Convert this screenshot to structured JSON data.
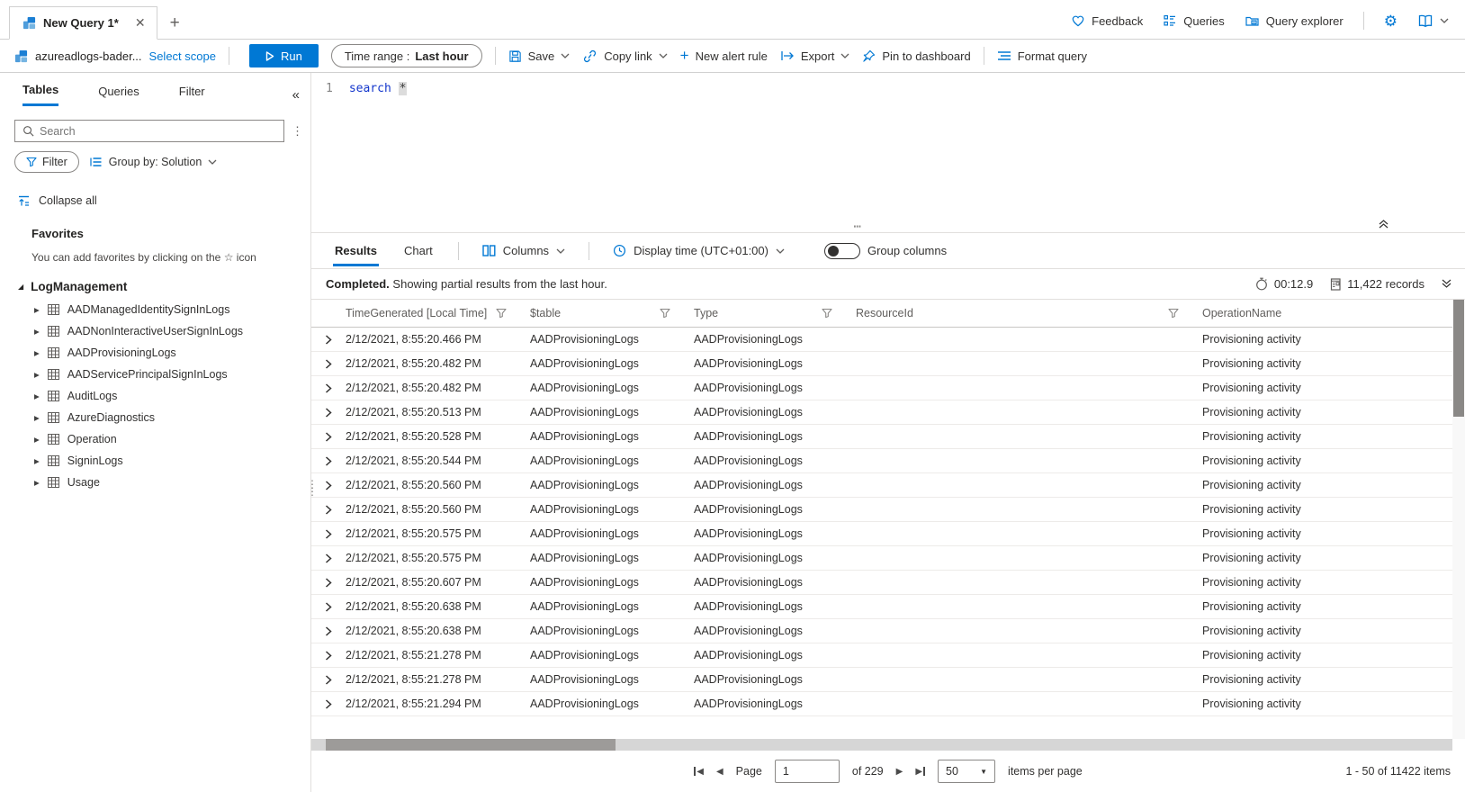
{
  "tab_bar": {
    "tab_title": "New Query 1*",
    "actions": {
      "feedback": "Feedback",
      "queries": "Queries",
      "query_explorer": "Query explorer"
    }
  },
  "toolbar": {
    "scope_name": "azureadlogs-bader...",
    "select_scope": "Select scope",
    "run_label": "Run",
    "time_range_label": "Time range :",
    "time_range_value": "Last hour",
    "save_label": "Save",
    "copy_link_label": "Copy link",
    "new_alert_rule_label": "New alert rule",
    "export_label": "Export",
    "pin_label": "Pin to dashboard",
    "format_query_label": "Format query"
  },
  "sidebar": {
    "tabs": [
      "Tables",
      "Queries",
      "Filter"
    ],
    "search_placeholder": "Search",
    "filter_button": "Filter",
    "group_by_label": "Group by: Solution",
    "collapse_all": "Collapse all",
    "favorites_title": "Favorites",
    "favorites_hint": "You can add favorites by clicking on the ☆ icon",
    "group_name": "LogManagement",
    "tables": [
      "AADManagedIdentitySignInLogs",
      "AADNonInteractiveUserSignInLogs",
      "AADProvisioningLogs",
      "AADServicePrincipalSignInLogs",
      "AuditLogs",
      "AzureDiagnostics",
      "Operation",
      "SigninLogs",
      "Usage"
    ]
  },
  "editor": {
    "line_number": "1",
    "keyword": "search",
    "operator": "*"
  },
  "results": {
    "tabs": [
      "Results",
      "Chart"
    ],
    "columns_label": "Columns",
    "display_time_label": "Display time (UTC+01:00)",
    "group_columns_label": "Group columns",
    "status": {
      "completed": "Completed.",
      "message": "Showing partial results from the last hour.",
      "elapsed": "00:12.9",
      "records": "11,422 records"
    }
  },
  "table": {
    "headers": [
      {
        "label": "TimeGenerated [Local Time]",
        "filter": true
      },
      {
        "label": "$table",
        "filter": true
      },
      {
        "label": "Type",
        "filter": true
      },
      {
        "label": "ResourceId",
        "filter": true
      },
      {
        "label": "OperationName",
        "filter": false
      }
    ],
    "rows": [
      {
        "time": "2/12/2021, 8:55:20.466 PM",
        "table": "AADProvisioningLogs",
        "type": "AADProvisioningLogs",
        "resource": "",
        "operation": "Provisioning activity"
      },
      {
        "time": "2/12/2021, 8:55:20.482 PM",
        "table": "AADProvisioningLogs",
        "type": "AADProvisioningLogs",
        "resource": "",
        "operation": "Provisioning activity"
      },
      {
        "time": "2/12/2021, 8:55:20.482 PM",
        "table": "AADProvisioningLogs",
        "type": "AADProvisioningLogs",
        "resource": "",
        "operation": "Provisioning activity"
      },
      {
        "time": "2/12/2021, 8:55:20.513 PM",
        "table": "AADProvisioningLogs",
        "type": "AADProvisioningLogs",
        "resource": "",
        "operation": "Provisioning activity"
      },
      {
        "time": "2/12/2021, 8:55:20.528 PM",
        "table": "AADProvisioningLogs",
        "type": "AADProvisioningLogs",
        "resource": "",
        "operation": "Provisioning activity"
      },
      {
        "time": "2/12/2021, 8:55:20.544 PM",
        "table": "AADProvisioningLogs",
        "type": "AADProvisioningLogs",
        "resource": "",
        "operation": "Provisioning activity"
      },
      {
        "time": "2/12/2021, 8:55:20.560 PM",
        "table": "AADProvisioningLogs",
        "type": "AADProvisioningLogs",
        "resource": "",
        "operation": "Provisioning activity"
      },
      {
        "time": "2/12/2021, 8:55:20.560 PM",
        "table": "AADProvisioningLogs",
        "type": "AADProvisioningLogs",
        "resource": "",
        "operation": "Provisioning activity"
      },
      {
        "time": "2/12/2021, 8:55:20.575 PM",
        "table": "AADProvisioningLogs",
        "type": "AADProvisioningLogs",
        "resource": "",
        "operation": "Provisioning activity"
      },
      {
        "time": "2/12/2021, 8:55:20.575 PM",
        "table": "AADProvisioningLogs",
        "type": "AADProvisioningLogs",
        "resource": "",
        "operation": "Provisioning activity"
      },
      {
        "time": "2/12/2021, 8:55:20.607 PM",
        "table": "AADProvisioningLogs",
        "type": "AADProvisioningLogs",
        "resource": "",
        "operation": "Provisioning activity"
      },
      {
        "time": "2/12/2021, 8:55:20.638 PM",
        "table": "AADProvisioningLogs",
        "type": "AADProvisioningLogs",
        "resource": "",
        "operation": "Provisioning activity"
      },
      {
        "time": "2/12/2021, 8:55:20.638 PM",
        "table": "AADProvisioningLogs",
        "type": "AADProvisioningLogs",
        "resource": "",
        "operation": "Provisioning activity"
      },
      {
        "time": "2/12/2021, 8:55:21.278 PM",
        "table": "AADProvisioningLogs",
        "type": "AADProvisioningLogs",
        "resource": "",
        "operation": "Provisioning activity"
      },
      {
        "time": "2/12/2021, 8:55:21.278 PM",
        "table": "AADProvisioningLogs",
        "type": "AADProvisioningLogs",
        "resource": "",
        "operation": "Provisioning activity"
      },
      {
        "time": "2/12/2021, 8:55:21.294 PM",
        "table": "AADProvisioningLogs",
        "type": "AADProvisioningLogs",
        "resource": "",
        "operation": "Provisioning activity"
      }
    ]
  },
  "pagination": {
    "page_label": "Page",
    "page_value": "1",
    "total_label": "of 229",
    "page_size": "50",
    "per_page_label": "items per page",
    "range_label": "1 - 50 of 11422 items"
  },
  "colors": {
    "accent": "#0078d4",
    "text": "#323130",
    "muted": "#605e5c"
  }
}
